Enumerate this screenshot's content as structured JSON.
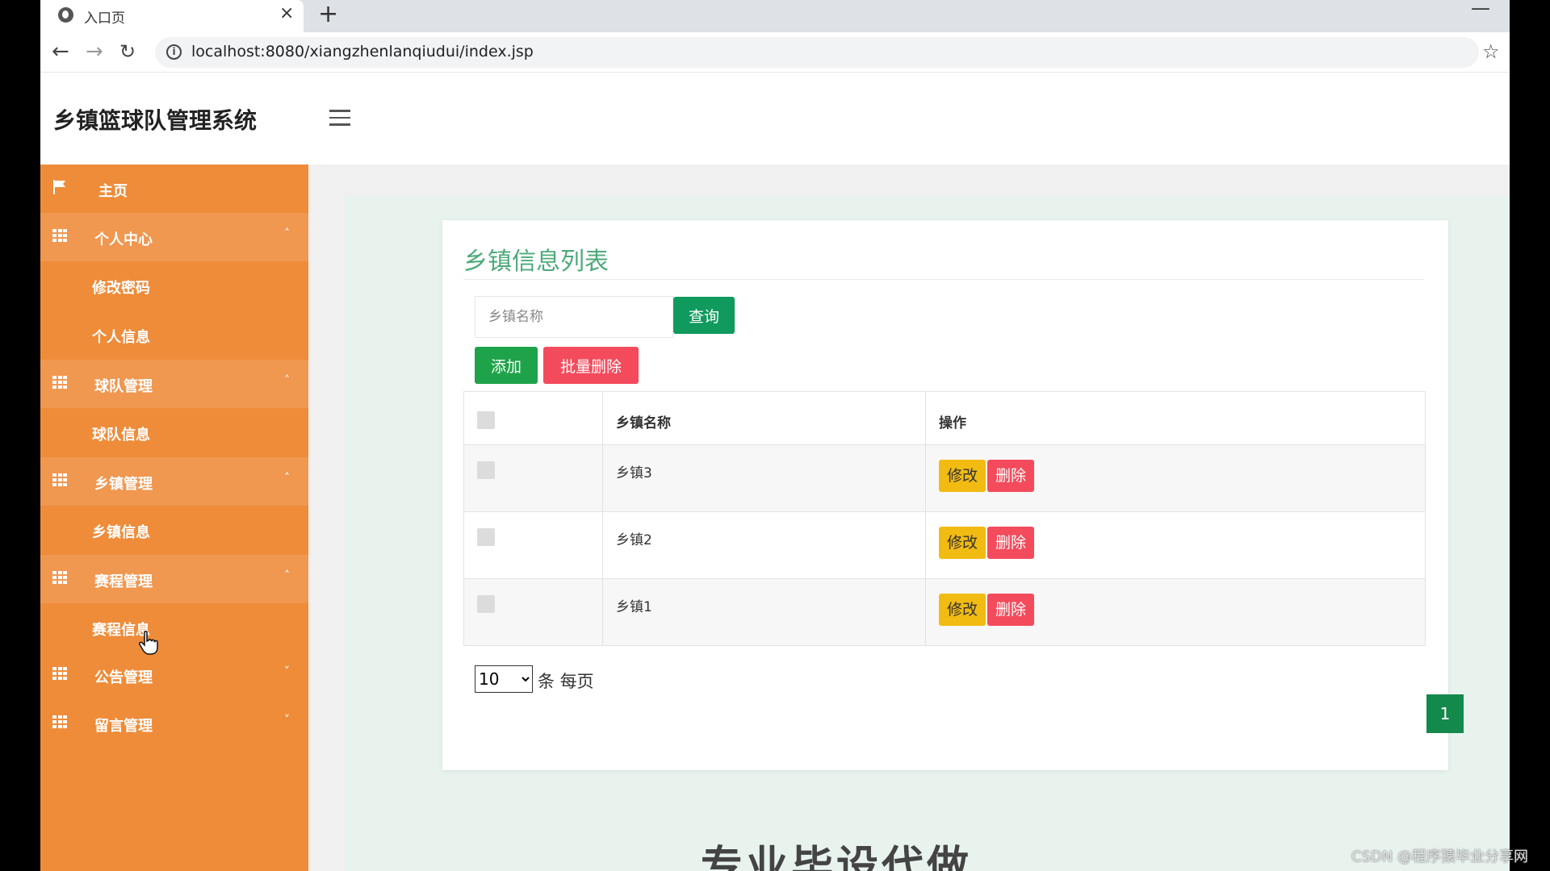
{
  "browser": {
    "tab_title": "入口页",
    "url": "localhost:8080/xiangzhenlanqiudui/index.jsp"
  },
  "app": {
    "title": "乡镇篮球队管理系统"
  },
  "sidebar": {
    "items": [
      {
        "label": "主页"
      },
      {
        "label": "个人中心"
      },
      {
        "label": "修改密码"
      },
      {
        "label": "个人信息"
      },
      {
        "label": "球队管理"
      },
      {
        "label": "球队信息"
      },
      {
        "label": "乡镇管理"
      },
      {
        "label": "乡镇信息"
      },
      {
        "label": "赛程管理"
      },
      {
        "label": "赛程信息"
      },
      {
        "label": "公告管理"
      },
      {
        "label": "留言管理"
      }
    ]
  },
  "card": {
    "title": "乡镇信息列表",
    "search_placeholder": "乡镇名称",
    "query_label": "查询",
    "add_label": "添加",
    "batch_delete_label": "批量删除"
  },
  "table": {
    "headers": [
      "乡镇名称",
      "操作"
    ],
    "rows": [
      {
        "name": "乡镇3"
      },
      {
        "name": "乡镇2"
      },
      {
        "name": "乡镇1"
      }
    ],
    "edit_label": "修改",
    "delete_label": "删除"
  },
  "pagination": {
    "page_size": "10",
    "page_size_suffix": "条 每页",
    "current_page": "1"
  },
  "slogan": "专业毕设代做",
  "watermark": "CSDN @程序猿毕业分享网"
}
